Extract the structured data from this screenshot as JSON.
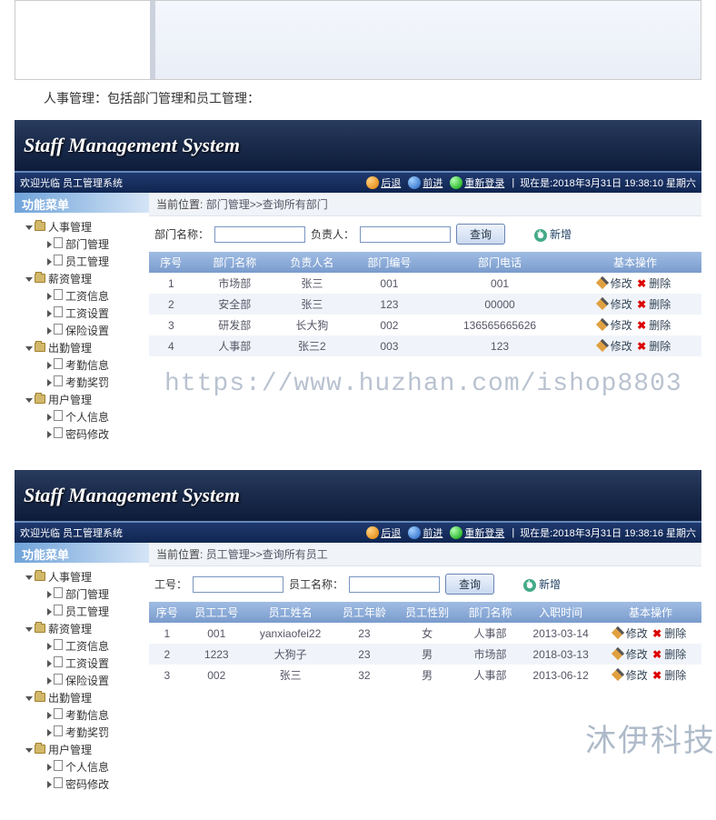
{
  "description": "人事管理：包括部门管理和员工管理：",
  "app_title": "Staff Management System",
  "watermark": "https://www.huzhan.com/ishop8803",
  "footer_mark": "沐伊科技",
  "toolbar": {
    "welcome": "欢迎光临 员工管理系统",
    "back": "后退",
    "forward": "前进",
    "relogin": "重新登录",
    "sep": "|"
  },
  "timestamps": {
    "dept": "现在是:2018年3月31日 19:38:10 星期六",
    "emp": "现在是:2018年3月31日 19:38:16 星期六"
  },
  "sidebar": {
    "title": "功能菜单",
    "groups": [
      {
        "label": "人事管理",
        "children": [
          {
            "label": "部门管理"
          },
          {
            "label": "员工管理"
          }
        ]
      },
      {
        "label": "薪资管理",
        "children": [
          {
            "label": "工资信息"
          },
          {
            "label": "工资设置"
          },
          {
            "label": "保险设置"
          }
        ]
      },
      {
        "label": "出勤管理",
        "children": [
          {
            "label": "考勤信息"
          },
          {
            "label": "考勤奖罚"
          }
        ]
      },
      {
        "label": "用户管理",
        "children": [
          {
            "label": "个人信息"
          },
          {
            "label": "密码修改"
          }
        ]
      }
    ]
  },
  "dept": {
    "breadcrumb_label": "当前位置:",
    "breadcrumb_path": "部门管理>>查询所有部门",
    "search": {
      "name_label": "部门名称：",
      "person_label": "负责人：",
      "btn": "查询",
      "add": "新增"
    },
    "columns": {
      "c0": "序号",
      "c1": "部门名称",
      "c2": "负责人名",
      "c3": "部门编号",
      "c4": "部门电话",
      "c5": "基本操作"
    },
    "actions": {
      "edit": "修改",
      "del": "删除"
    },
    "rows": [
      {
        "idx": "1",
        "name": "市场部",
        "leader": "张三",
        "code": "001",
        "tel": "001"
      },
      {
        "idx": "2",
        "name": "安全部",
        "leader": "张三",
        "code": "123",
        "tel": "00000"
      },
      {
        "idx": "3",
        "name": "研发部",
        "leader": "长大狗",
        "code": "002",
        "tel": "136565665626"
      },
      {
        "idx": "4",
        "name": "人事部",
        "leader": "张三2",
        "code": "003",
        "tel": "123"
      }
    ]
  },
  "emp": {
    "breadcrumb_label": "当前位置:",
    "breadcrumb_path": "员工管理>>查询所有员工",
    "search": {
      "id_label": "工号：",
      "name_label": "员工名称：",
      "btn": "查询",
      "add": "新增"
    },
    "columns": {
      "c0": "序号",
      "c1": "员工工号",
      "c2": "员工姓名",
      "c3": "员工年龄",
      "c4": "员工性别",
      "c5": "部门名称",
      "c6": "入职时间",
      "c7": "基本操作"
    },
    "actions": {
      "edit": "修改",
      "del": "删除"
    },
    "rows": [
      {
        "idx": "1",
        "no": "001",
        "name": "yanxiaofei22",
        "age": "23",
        "sex": "女",
        "dept": "人事部",
        "date": "2013-03-14"
      },
      {
        "idx": "2",
        "no": "1223",
        "name": "大狗子",
        "age": "23",
        "sex": "男",
        "dept": "市场部",
        "date": "2018-03-13"
      },
      {
        "idx": "3",
        "no": "002",
        "name": "张三",
        "age": "32",
        "sex": "男",
        "dept": "人事部",
        "date": "2013-06-12"
      }
    ]
  }
}
